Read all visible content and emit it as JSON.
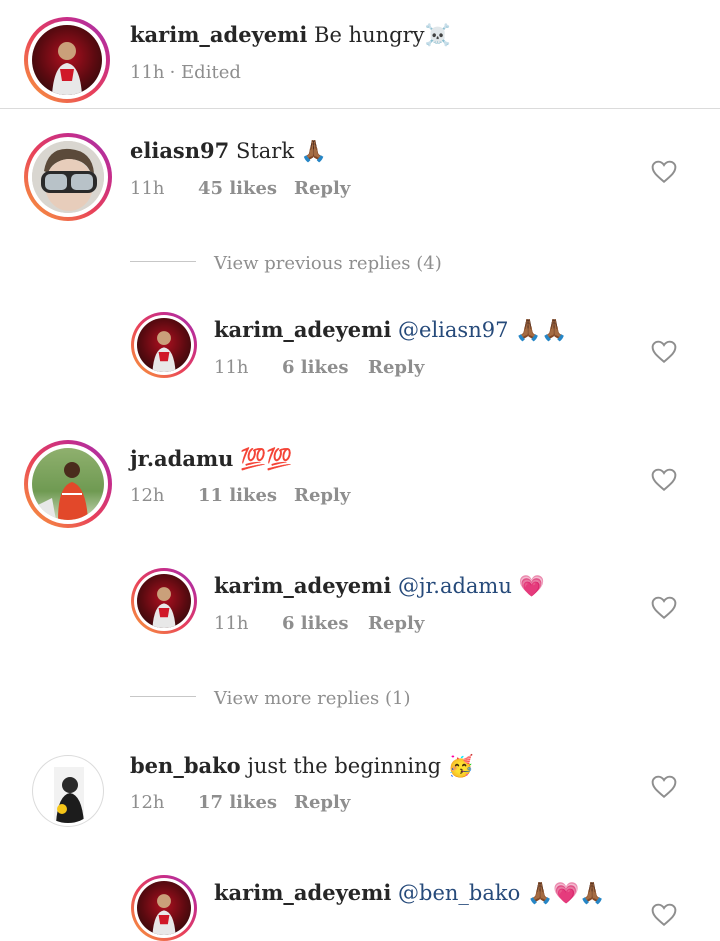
{
  "caption": {
    "username": "karim_adeyemi",
    "text": "Be hungry☠️",
    "time": "11h",
    "edited": "· Edited"
  },
  "comments": [
    {
      "username": "eliasn97",
      "text": "Stark 🙏🏾",
      "time": "11h",
      "likes": "45 likes",
      "reply": "Reply",
      "avatar": "goggles-avatar"
    },
    {
      "username": "karim_adeyemi",
      "mention": "@eliasn97",
      "text": "🙏🏾🙏🏾",
      "time": "11h",
      "likes": "6 likes",
      "reply": "Reply"
    },
    {
      "username": "jr.adamu",
      "text": "💯💯",
      "time": "12h",
      "likes": "11 likes",
      "reply": "Reply"
    },
    {
      "username": "karim_adeyemi",
      "mention": "@jr.adamu",
      "text": "💗",
      "time": "11h",
      "likes": "6 likes",
      "reply": "Reply"
    },
    {
      "username": "ben_bako",
      "text": "just the beginning 🥳",
      "time": "12h",
      "likes": "17 likes",
      "reply": "Reply"
    },
    {
      "username": "karim_adeyemi",
      "mention": "@ben_bako",
      "text": "🙏🏾💗🙏🏾"
    }
  ],
  "view_previous_replies": "View previous replies (4)",
  "view_more_replies": "View more replies (1)",
  "colors": {
    "ring_gradient_start": "#f9a13a",
    "ring_gradient_end": "#9b36b7",
    "mention": "#264a7a",
    "meta": "#8e8e8e"
  }
}
